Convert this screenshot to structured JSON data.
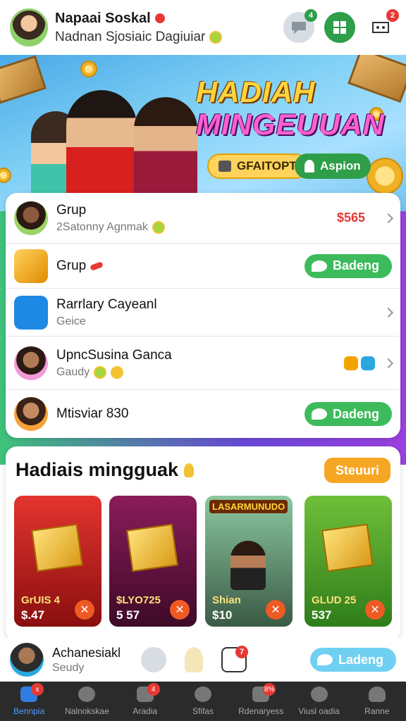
{
  "header": {
    "user_name": "Napaai Soskal",
    "user_subtitle": "Nadnan Sjosiaic Dagiuiar",
    "chat_badge": "4",
    "bell_badge": "2"
  },
  "banner": {
    "title_line1": "HADIAH",
    "title_line2": "MINGEUUAN",
    "btn_gold": "GFAITOPT",
    "btn_green": "Aspion"
  },
  "list": {
    "rows": [
      {
        "title": "Grup",
        "subtitle": "2Satonny Agnmak",
        "price": "$565"
      },
      {
        "title": "Grup",
        "button": "Badeng"
      },
      {
        "title": "Rarrlary Cayeanl",
        "subtitle": "Geice"
      },
      {
        "title": "UpncSusina Ganca",
        "subtitle": "Gaudy"
      },
      {
        "title": "Mtisviar 830",
        "button": "Dadeng"
      }
    ]
  },
  "rewards": {
    "title": "Hadiais mingguak",
    "see_all": "Steuuri",
    "tiles": [
      {
        "label": "GrUIS 4",
        "value": "$.47",
        "color_top": "#e3342f",
        "color_bottom": "#8a0f0f"
      },
      {
        "label": "$LYO725",
        "value": "5 57",
        "color_top": "#8a1c5a",
        "color_bottom": "#3e0a28"
      },
      {
        "label": "Shian",
        "value": "$10",
        "banner": "LASARMUNUDO",
        "color_top": "#4a8c5a",
        "color_bottom": "#2a3a2a"
      },
      {
        "label": "GLUD 25",
        "value": "537",
        "color_top": "#6fbf3a",
        "color_bottom": "#2f7d1a"
      }
    ]
  },
  "notification": {
    "title": "Achanesiakl",
    "subtitle": "Seudy",
    "button": "Ladeng",
    "badge": "7"
  },
  "nav": {
    "items": [
      {
        "label": "Bennpia",
        "badge": "x",
        "active": true
      },
      {
        "label": "Nalnokskae",
        "active": false
      },
      {
        "label": "Aradia",
        "badge": "4",
        "active": false
      },
      {
        "label": "Sfifas",
        "active": false
      },
      {
        "label": "Rdenaryess",
        "badge": "8%",
        "active": false
      },
      {
        "label": "Viusl oadia",
        "active": false
      },
      {
        "label": "Ranne",
        "active": false
      }
    ]
  },
  "colors": {
    "accent_green": "#3dbb5c",
    "accent_orange": "#f7a623",
    "price_red": "#e53935",
    "nav_active": "#4a9dff"
  }
}
